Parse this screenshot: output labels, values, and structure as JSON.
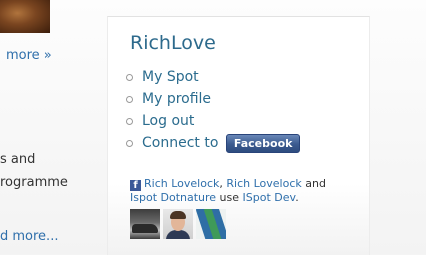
{
  "left_column": {
    "more_link_top": "more »",
    "snippet_line_1": "s and",
    "snippet_line_2": "rogramme",
    "more_link_bottom": "d more..."
  },
  "widget": {
    "title": "RichLove",
    "menu": {
      "my_spot": "My Spot",
      "my_profile": "My profile",
      "log_out": "Log out",
      "connect_to": "Connect to",
      "facebook_button": "Facebook"
    },
    "social": {
      "user_1": "Rich Lovelock",
      "sep_1": ", ",
      "user_2": "Rich Lovelock",
      "and": " and ",
      "user_3": "Ispot Dotnature",
      "use": " use ",
      "app": "ISpot Dev",
      "end": "."
    }
  },
  "colors": {
    "title": "#2d6a8c",
    "link": "#2f6fab",
    "facebook_blue": "#3b5998"
  }
}
